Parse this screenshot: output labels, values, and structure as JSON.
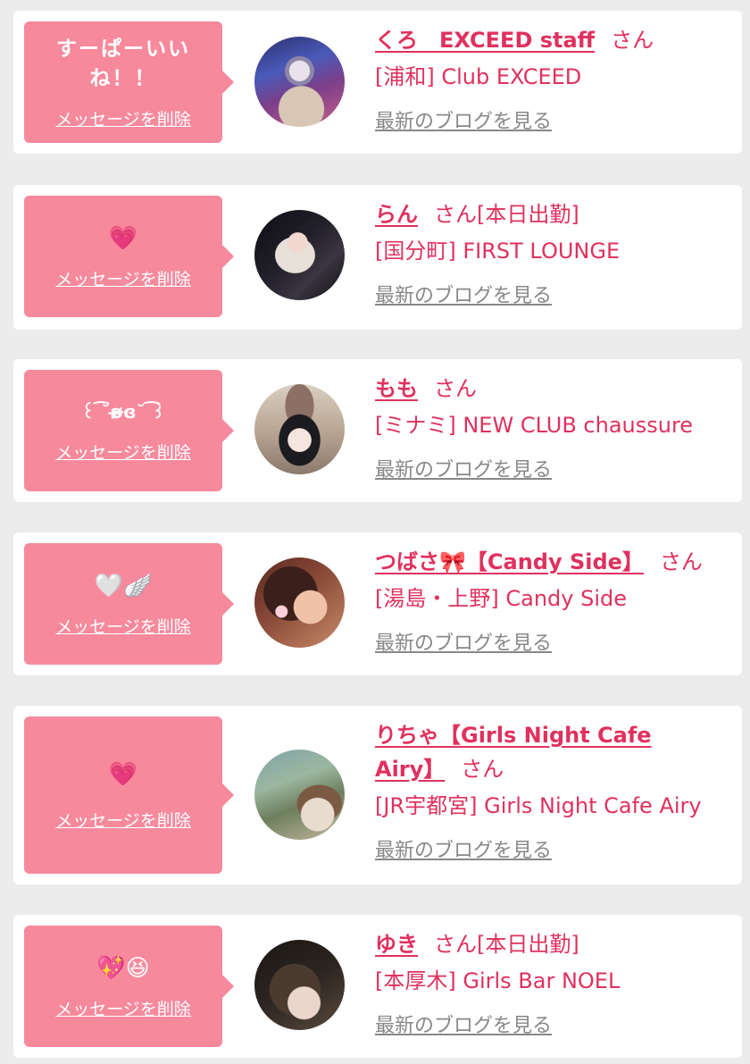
{
  "delete_label": "メッセージを削除",
  "san_suffix": "さん",
  "blog_label": "最新のブログを見る",
  "items": [
    {
      "message": "すーぱーいいね！！",
      "name": "くろ　EXCEED staff",
      "status": "",
      "shop": "[浦和] Club EXCEED"
    },
    {
      "message": "💗",
      "name": "らん",
      "status": "[本日出勤]",
      "shop": "[国分町] FIRST LOUNGE"
    },
    {
      "message": "꒰ ͡˘ʚ̴̶̷̷ɞ˘ ͡꒱",
      "name": "もも",
      "status": "",
      "shop": "[ミナミ] NEW CLUB chaussure"
    },
    {
      "message": "🤍🪽",
      "name": "つばさ🎀【Candy Side】",
      "status": "",
      "shop": "[湯島・上野] Candy Side"
    },
    {
      "message": "💗",
      "name": "りちゃ【Girls Night Cafe Airy】",
      "status": "",
      "shop": "[JR宇都宮] Girls Night Cafe Airy"
    },
    {
      "message": "💖😆",
      "name": "ゆき",
      "status": "[本日出勤]",
      "shop": "[本厚木] Girls Bar NOEL"
    }
  ]
}
